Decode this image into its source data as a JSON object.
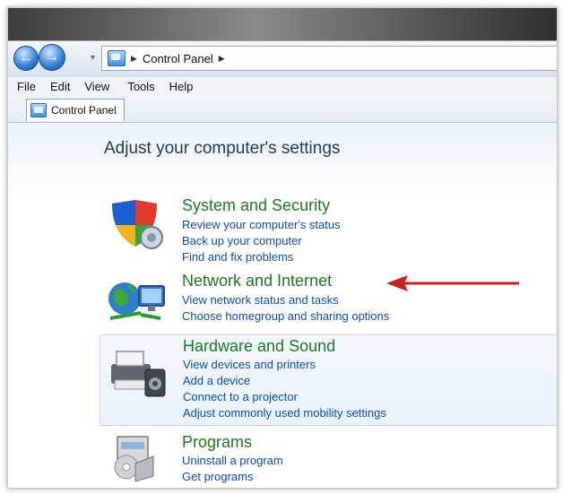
{
  "address": {
    "crumb": "Control Panel"
  },
  "menu": [
    "File",
    "Edit",
    "View",
    "Tools",
    "Help"
  ],
  "tab": {
    "label": "Control Panel"
  },
  "page": {
    "title": "Adjust your computer's settings"
  },
  "categories": [
    {
      "title": "System and Security",
      "icon": "shield-icon",
      "links": [
        "Review your computer's status",
        "Back up your computer",
        "Find and fix problems"
      ]
    },
    {
      "title": "Network and Internet",
      "icon": "network-icon",
      "links": [
        "View network status and tasks",
        "Choose homegroup and sharing options"
      ]
    },
    {
      "title": "Hardware and Sound",
      "icon": "printer-icon",
      "links": [
        "View devices and printers",
        "Add a device",
        "Connect to a projector",
        "Adjust commonly used mobility settings"
      ]
    },
    {
      "title": "Programs",
      "icon": "programs-icon",
      "links": [
        "Uninstall a program",
        "Get programs"
      ]
    }
  ],
  "colors": {
    "category_title": "#1e7b22",
    "link": "#0b4cc2",
    "annotation_arrow": "#d01f1f",
    "page_title": "#1e3a5f"
  }
}
